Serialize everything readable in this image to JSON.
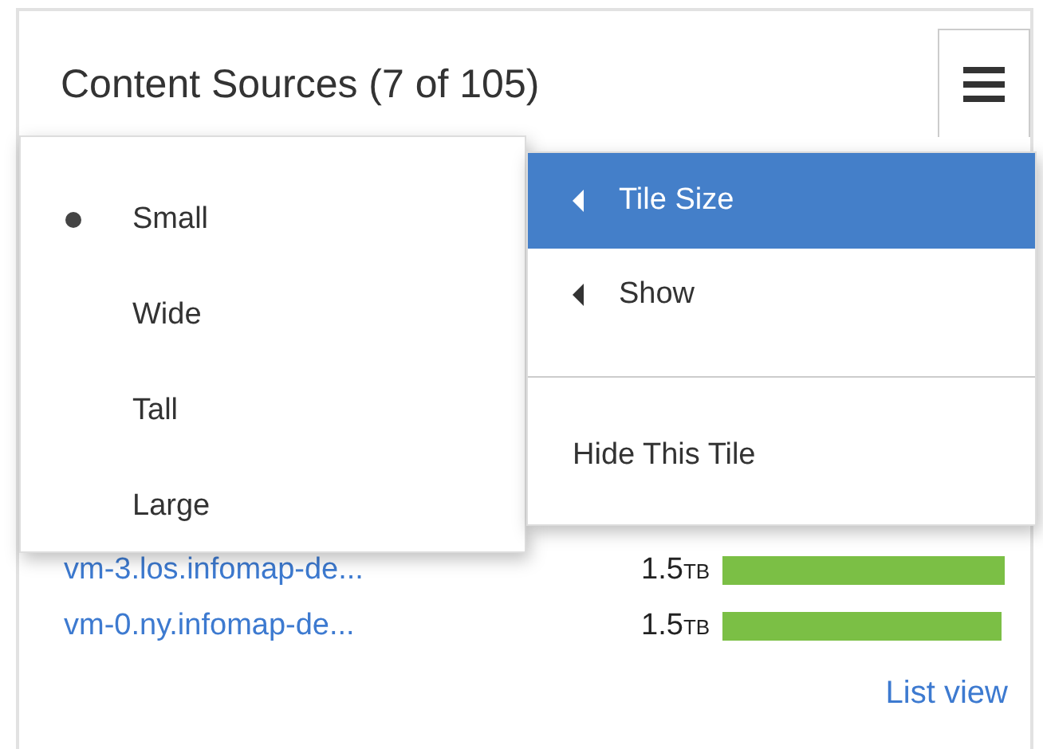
{
  "tile": {
    "title": "Content Sources (7 of 105)"
  },
  "size_menu": [
    {
      "label": "Small",
      "selected": true
    },
    {
      "label": "Wide",
      "selected": false
    },
    {
      "label": "Tall",
      "selected": false
    },
    {
      "label": "Large",
      "selected": false
    }
  ],
  "main_menu": [
    {
      "kind": "submenu",
      "label": "Tile Size",
      "selected": true
    },
    {
      "kind": "submenu",
      "label": "Show",
      "selected": false
    },
    {
      "kind": "divider"
    },
    {
      "kind": "action",
      "label": "Hide This Tile",
      "selected": false
    }
  ],
  "rows": [
    {
      "name": "vm-3.los.infomap-de...",
      "size": "1.5",
      "unit": "TB",
      "level": 0.99
    },
    {
      "name": "vm-0.ny.infomap-de...",
      "size": "1.5",
      "unit": "TB",
      "level": 0.975
    }
  ],
  "footer_link": "List view"
}
